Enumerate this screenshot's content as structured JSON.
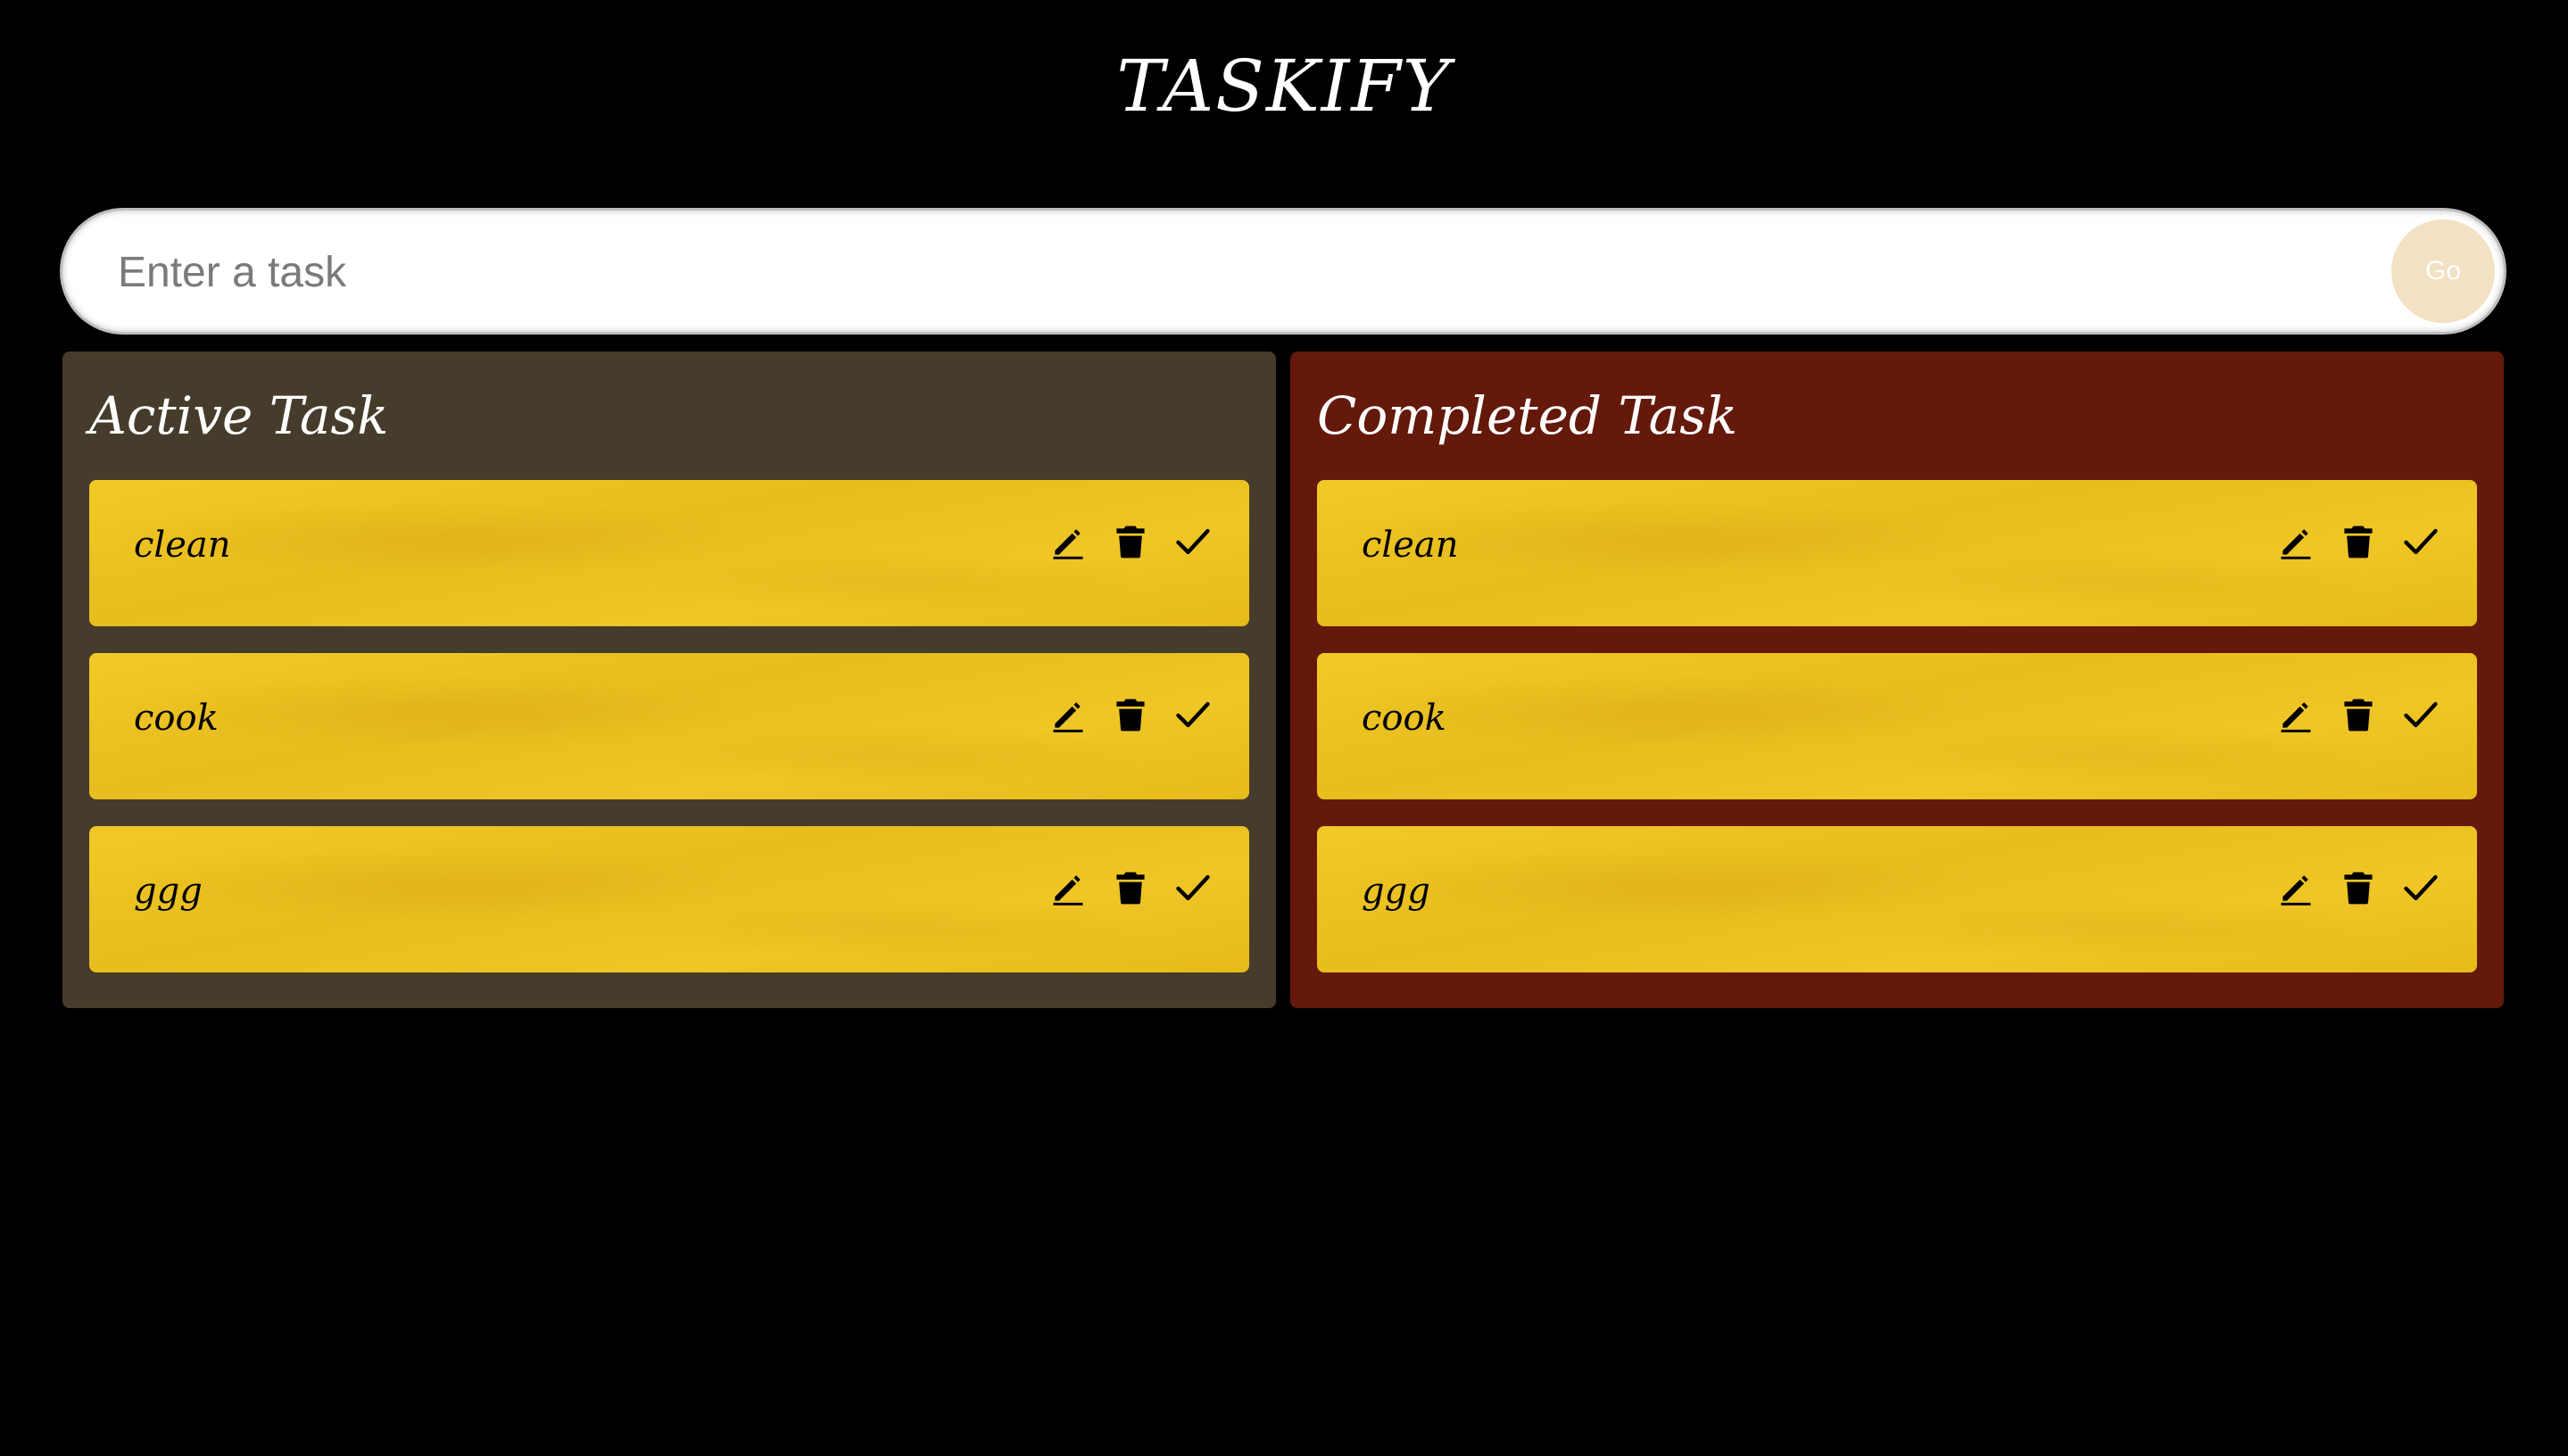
{
  "app": {
    "title": "TASKIFY"
  },
  "form": {
    "placeholder": "Enter a task",
    "value": "",
    "submit_label": "Go"
  },
  "panels": {
    "active": {
      "heading": "Active Task",
      "tasks": [
        {
          "text": "clean"
        },
        {
          "text": "cook"
        },
        {
          "text": "ggg"
        }
      ]
    },
    "completed": {
      "heading": "Completed Task",
      "tasks": [
        {
          "text": "clean"
        },
        {
          "text": "cook"
        },
        {
          "text": "ggg"
        }
      ]
    }
  },
  "icons": {
    "edit": "edit-icon",
    "delete": "trash-icon",
    "done": "check-icon"
  },
  "colors": {
    "background": "#000000",
    "active_panel": "#463c2b",
    "completed_panel": "#64190b",
    "task_card": "#efc626",
    "go_button": "#f3e1c3"
  }
}
